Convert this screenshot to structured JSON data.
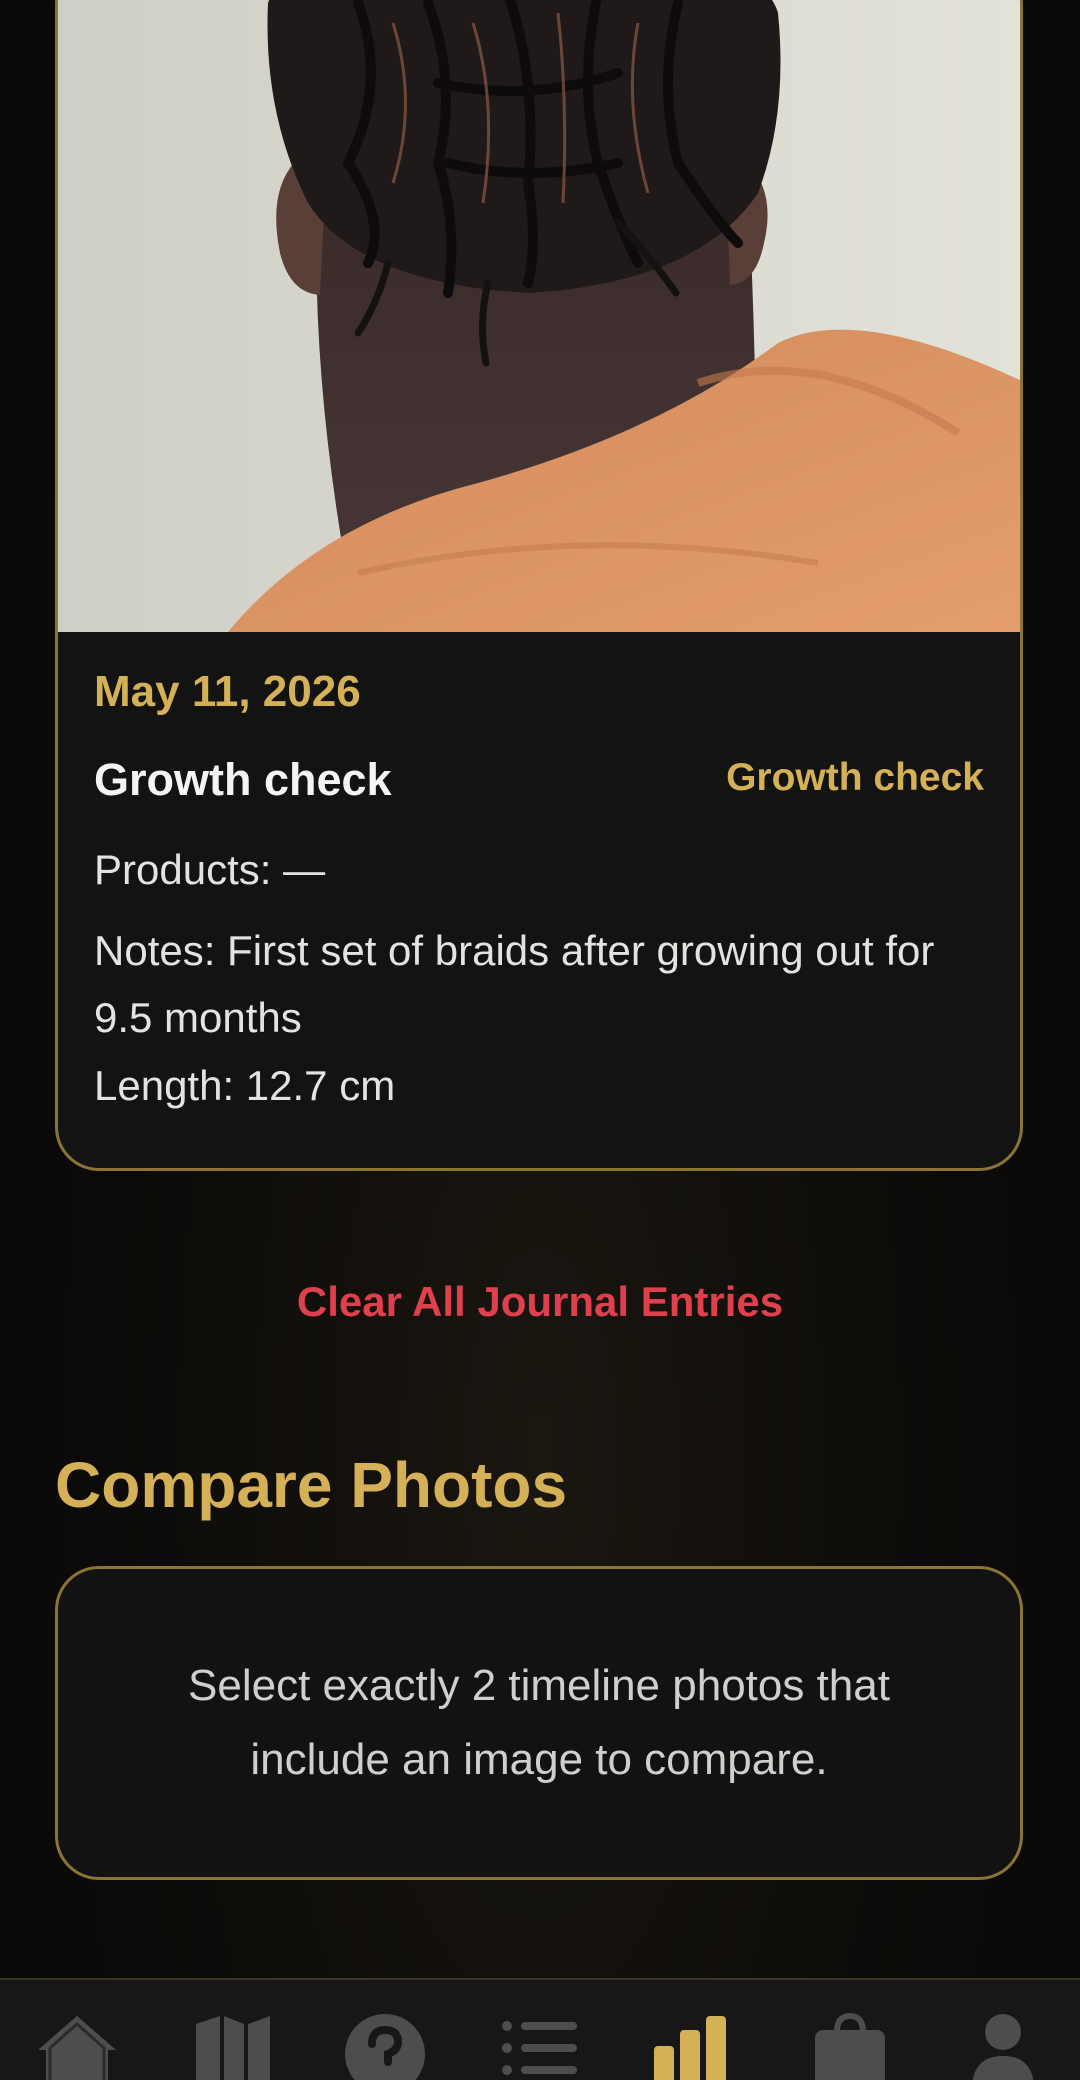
{
  "entry": {
    "date": "May 11, 2026",
    "title": "Growth check",
    "tag": "Growth check",
    "products": "Products: —",
    "notes": "Notes: First set of braids after growing out for 9.5 months",
    "length": "Length: 12.7 cm"
  },
  "clear_button": "Clear All Journal Entries",
  "compare": {
    "title": "Compare Photos",
    "message": "Select exactly 2 timeline photos that include an image to compare."
  },
  "tabbar": {
    "items": [
      {
        "icon": "home-icon"
      },
      {
        "icon": "map-icon"
      },
      {
        "icon": "help-icon"
      },
      {
        "icon": "list-icon"
      },
      {
        "icon": "chart-icon",
        "active": true
      },
      {
        "icon": "shopping-bag-icon"
      },
      {
        "icon": "profile-icon"
      }
    ]
  },
  "colors": {
    "accent_gold": "#d4b057",
    "destructive_red": "#e0404c",
    "card_border": "#8a7436",
    "background": "#0b0a09"
  }
}
